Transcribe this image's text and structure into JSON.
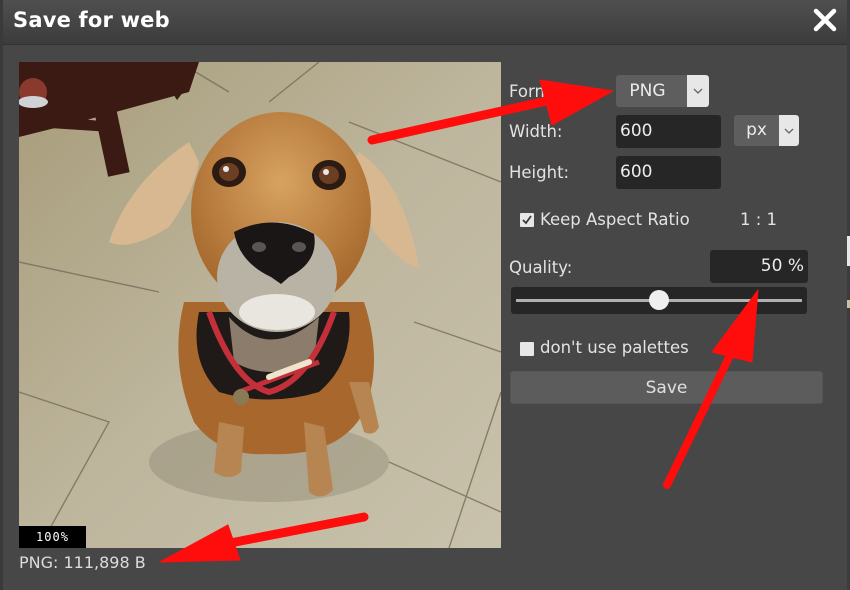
{
  "dialog": {
    "title": "Save for web",
    "close_icon": "close-icon"
  },
  "preview": {
    "zoom_level": "100%",
    "file_info": "PNG: 111,898 B",
    "image_description": "photo of a tan and black dog with red collar sitting on tiled floor"
  },
  "settings": {
    "format": {
      "label": "Format:",
      "value": "PNG"
    },
    "width": {
      "label": "Width:",
      "value": "600"
    },
    "unit": {
      "value": "px"
    },
    "height": {
      "label": "Height:",
      "value": "600"
    },
    "keep_aspect": {
      "label": "Keep Aspect Ratio",
      "checked": true,
      "ratio": "1 : 1"
    },
    "quality": {
      "label": "Quality:",
      "value": "50 %",
      "percent": 50
    },
    "palettes": {
      "label": "don't use palettes",
      "checked": false
    },
    "save_label": "Save"
  },
  "annotations": {
    "arrow_color": "#ff0d0d",
    "count": 3
  },
  "colors": {
    "dialog_bg": "#474747",
    "input_bg": "#262626",
    "select_bg": "#5e5e5e",
    "button_bg": "#5c5c5c"
  }
}
